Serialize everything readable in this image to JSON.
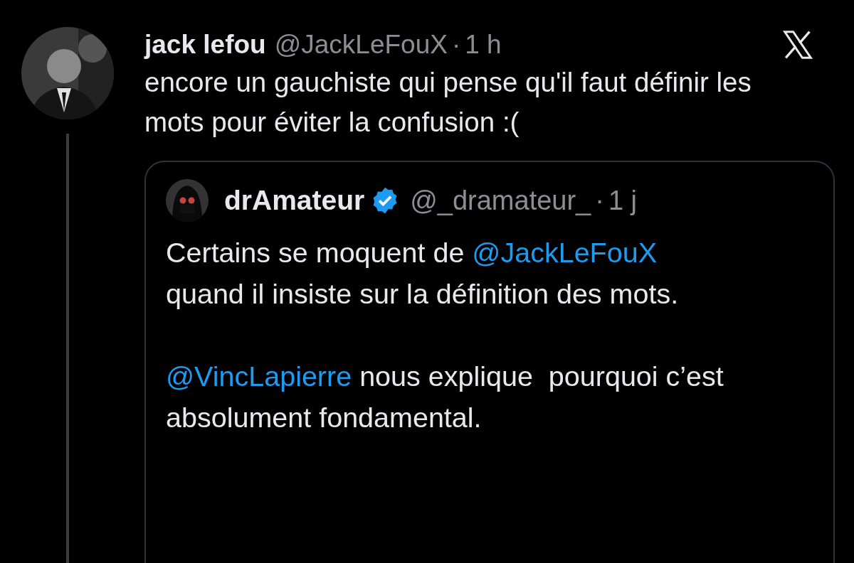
{
  "post": {
    "author": "jack lefou",
    "handle": "@JackLeFouX",
    "separator": "·",
    "time": "1 h",
    "text": "encore un gauchiste qui pense qu'il faut définir les mots pour éviter la confusion :(",
    "thread_line": true,
    "quote": {
      "author": "drAmateur",
      "verified": true,
      "handle": "@_dramateur_",
      "separator": "·",
      "time": "1 j",
      "paragraphs": [
        [
          {
            "kind": "text",
            "text": "Certains se moquent de "
          },
          {
            "kind": "mention",
            "text": "@JackLeFouX"
          },
          {
            "kind": "text",
            "text": " quand il insiste sur la définition des mots."
          }
        ],
        [
          {
            "kind": "mention",
            "text": "@VincLapierre"
          },
          {
            "kind": "text",
            "text": " nous explique  pourquoi c’est absolument fondamental."
          }
        ]
      ]
    }
  }
}
